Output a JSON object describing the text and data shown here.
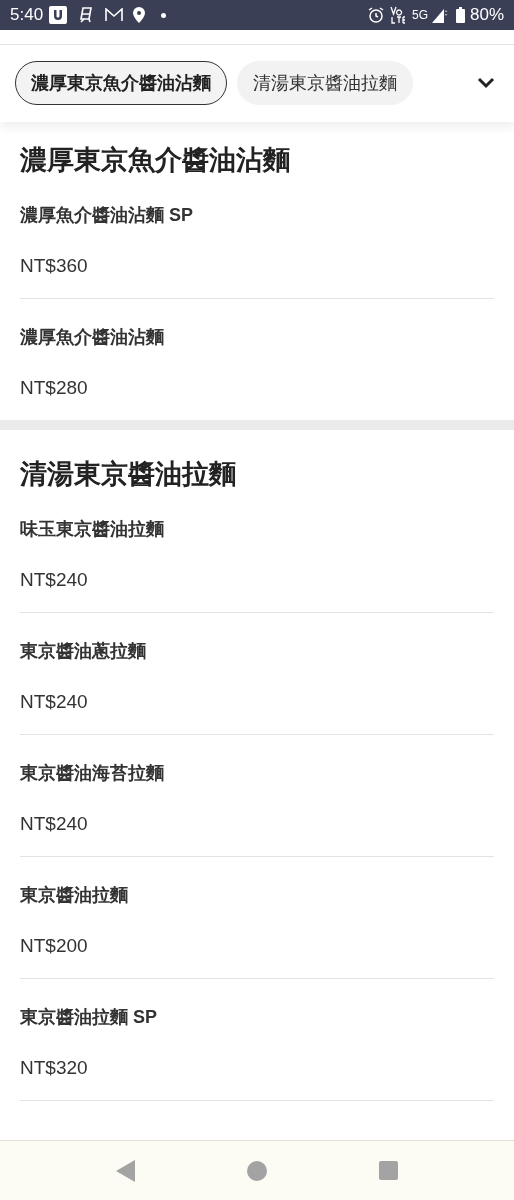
{
  "status_bar": {
    "time": "5:40",
    "network": "5G",
    "battery": "80%"
  },
  "tabs": [
    {
      "label": "濃厚東京魚介醬油沾麵",
      "selected": true
    },
    {
      "label": "清湯東京醬油拉麵",
      "selected": false
    }
  ],
  "sections": [
    {
      "title": "濃厚東京魚介醬油沾麵",
      "items": [
        {
          "name": "濃厚魚介醬油沾麵 SP",
          "price": "NT$360"
        },
        {
          "name": "濃厚魚介醬油沾麵",
          "price": "NT$280"
        }
      ]
    },
    {
      "title": "清湯東京醬油拉麵",
      "items": [
        {
          "name": "味玉東京醬油拉麵",
          "price": "NT$240"
        },
        {
          "name": "東京醬油蔥拉麵",
          "price": "NT$240"
        },
        {
          "name": "東京醬油海苔拉麵",
          "price": "NT$240"
        },
        {
          "name": "東京醬油拉麵",
          "price": "NT$200"
        },
        {
          "name": "東京醬油拉麵 SP",
          "price": "NT$320"
        }
      ]
    }
  ]
}
